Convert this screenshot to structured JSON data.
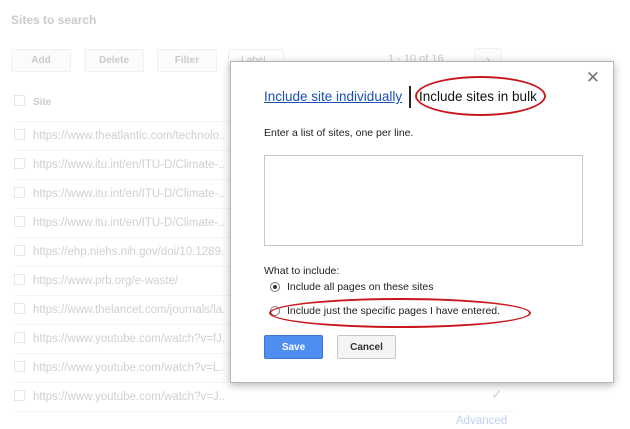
{
  "background": {
    "title": "Sites to search",
    "toolbar": {
      "add": "Add",
      "delete": "Delete",
      "filter": "Filter",
      "label": "Label"
    },
    "pager": {
      "range": "1 - 10 of 16",
      "next": "›"
    },
    "table_header": "Site",
    "rows": [
      "https://www.theatlantic.com/technolo...",
      "https://www.itu.int/en/ITU-D/Climate-...",
      "https://www.itu.int/en/ITU-D/Climate-...",
      "https://www.itu.int/en/ITU-D/Climate-...",
      "https://ehp.niehs.nih.gov/doi/10.1289...",
      "https://www.prb.org/e-waste/",
      "https://www.thelancet.com/journals/la...",
      "https://www.youtube.com/watch?v=fJ...",
      "https://www.youtube.com/watch?v=L...",
      "https://www.youtube.com/watch?v=J..."
    ],
    "check": "✓",
    "advanced": "Advanced"
  },
  "dialog": {
    "close": "✕",
    "tab_individual": "Include site individually",
    "tab_bulk": "Include sites in bulk",
    "instruction": "Enter a list of sites, one per line.",
    "textarea_value": "",
    "what_to_include": "What to include:",
    "options": [
      {
        "label": "Include all pages on these sites",
        "checked": true
      },
      {
        "label": "Include just the specific pages I have entered.",
        "checked": false
      }
    ],
    "save": "Save",
    "cancel": "Cancel"
  },
  "colors": {
    "accent": "#4d8ef0",
    "highlight": "#c8181e",
    "link": "#1a4fb5"
  }
}
